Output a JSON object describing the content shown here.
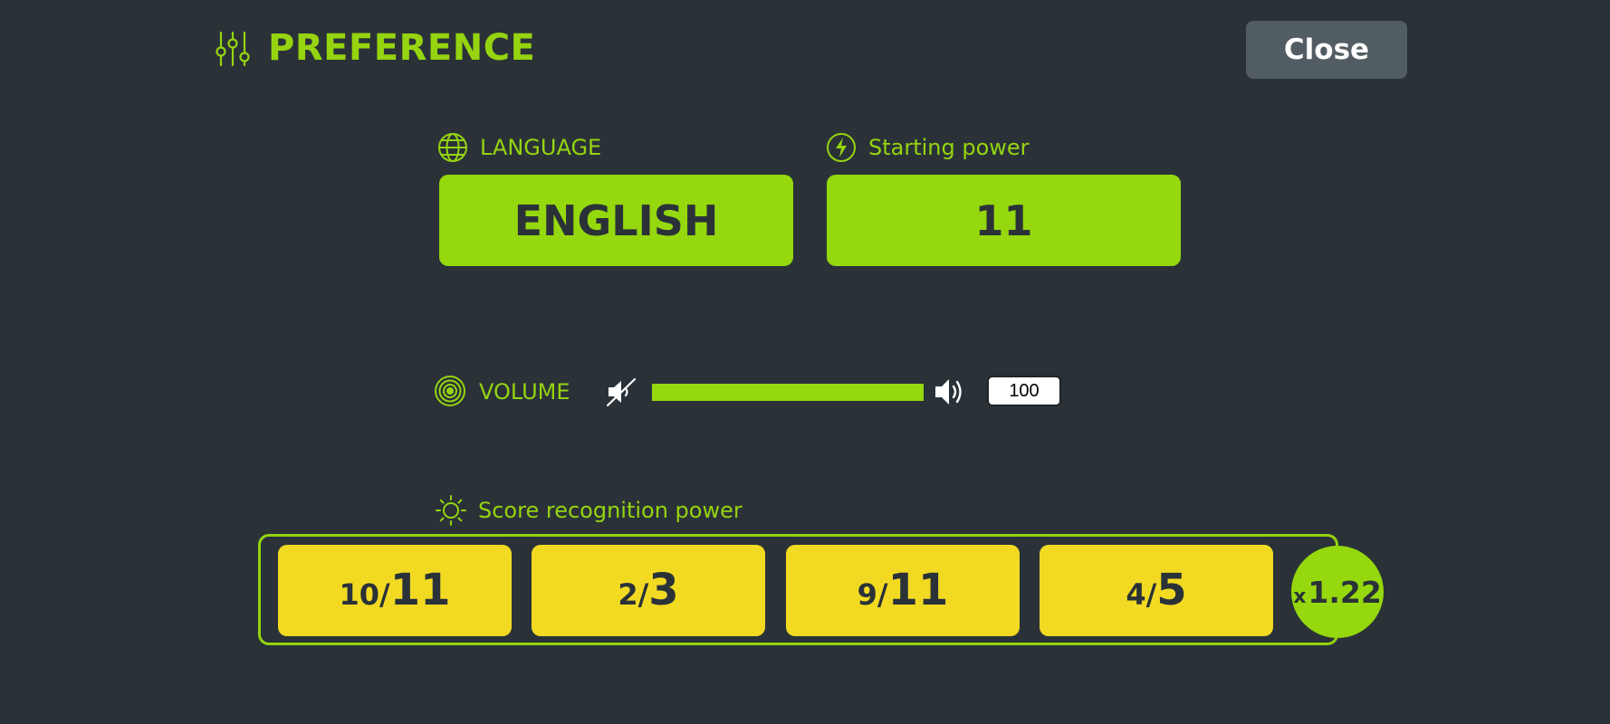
{
  "header": {
    "title": "PREFERENCE",
    "close_label": "Close"
  },
  "language": {
    "label": "LANGUAGE",
    "value": "ENGLISH"
  },
  "starting_power": {
    "label": "Starting power",
    "value": "11"
  },
  "volume": {
    "label": "VOLUME",
    "value": "100",
    "level": 100
  },
  "score_recognition": {
    "label": "Score recognition power",
    "cards": [
      {
        "numerator": "10",
        "denominator": "11"
      },
      {
        "numerator": "2",
        "denominator": "3"
      },
      {
        "numerator": "9",
        "denominator": "11"
      },
      {
        "numerator": "4",
        "denominator": "5"
      }
    ],
    "multiplier_prefix": "x",
    "multiplier_value": "1.22"
  },
  "colors": {
    "background": "#2a3238",
    "accent": "#95d40f",
    "card": "#f2da22",
    "close_button": "#525d63"
  },
  "icons": {
    "title": "sliders-icon",
    "language": "globe-icon",
    "starting_power": "lightning-icon",
    "volume": "target-rings-icon",
    "score_recognition": "sun-icon",
    "mute": "speaker-mute-icon",
    "speaker": "speaker-loud-icon"
  }
}
